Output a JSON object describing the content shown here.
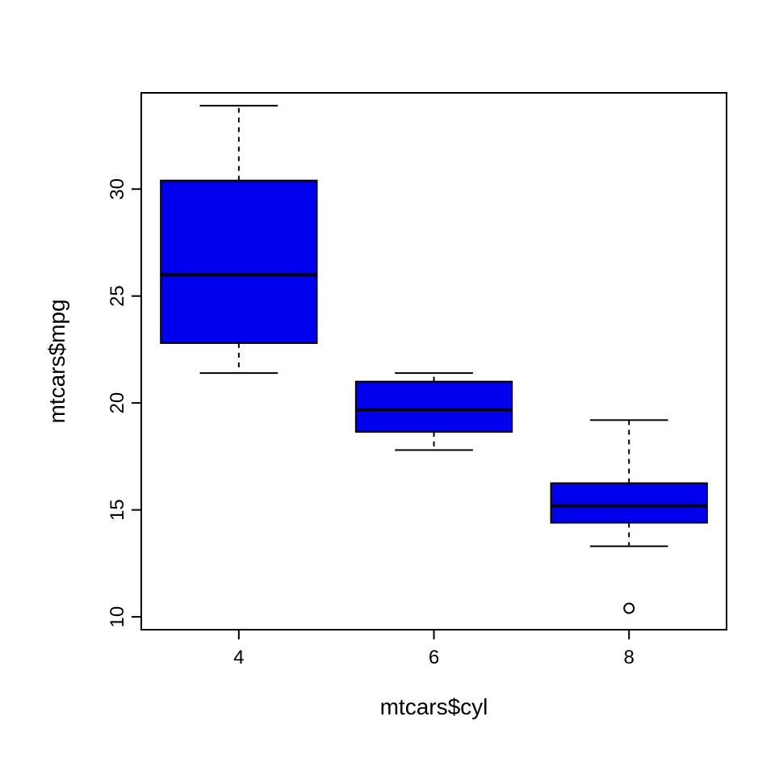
{
  "chart_data": {
    "type": "boxplot",
    "xlabel": "mtcars$cyl",
    "ylabel": "mtcars$mpg",
    "fill": "#0000EE",
    "categories": [
      "4",
      "6",
      "8"
    ],
    "y_ticks": [
      10,
      15,
      20,
      25,
      30
    ],
    "ylim": [
      9.4,
      34.5
    ],
    "boxes": [
      {
        "category": "4",
        "min": 21.4,
        "q1": 22.8,
        "median": 26.0,
        "q3": 30.4,
        "max": 33.9,
        "outliers": []
      },
      {
        "category": "6",
        "min": 17.8,
        "q1": 18.65,
        "median": 19.7,
        "q3": 21.0,
        "max": 21.4,
        "outliers": []
      },
      {
        "category": "8",
        "min": 13.3,
        "q1": 14.4,
        "median": 15.2,
        "q3": 16.25,
        "max": 19.2,
        "outliers": [
          10.4
        ]
      }
    ]
  }
}
